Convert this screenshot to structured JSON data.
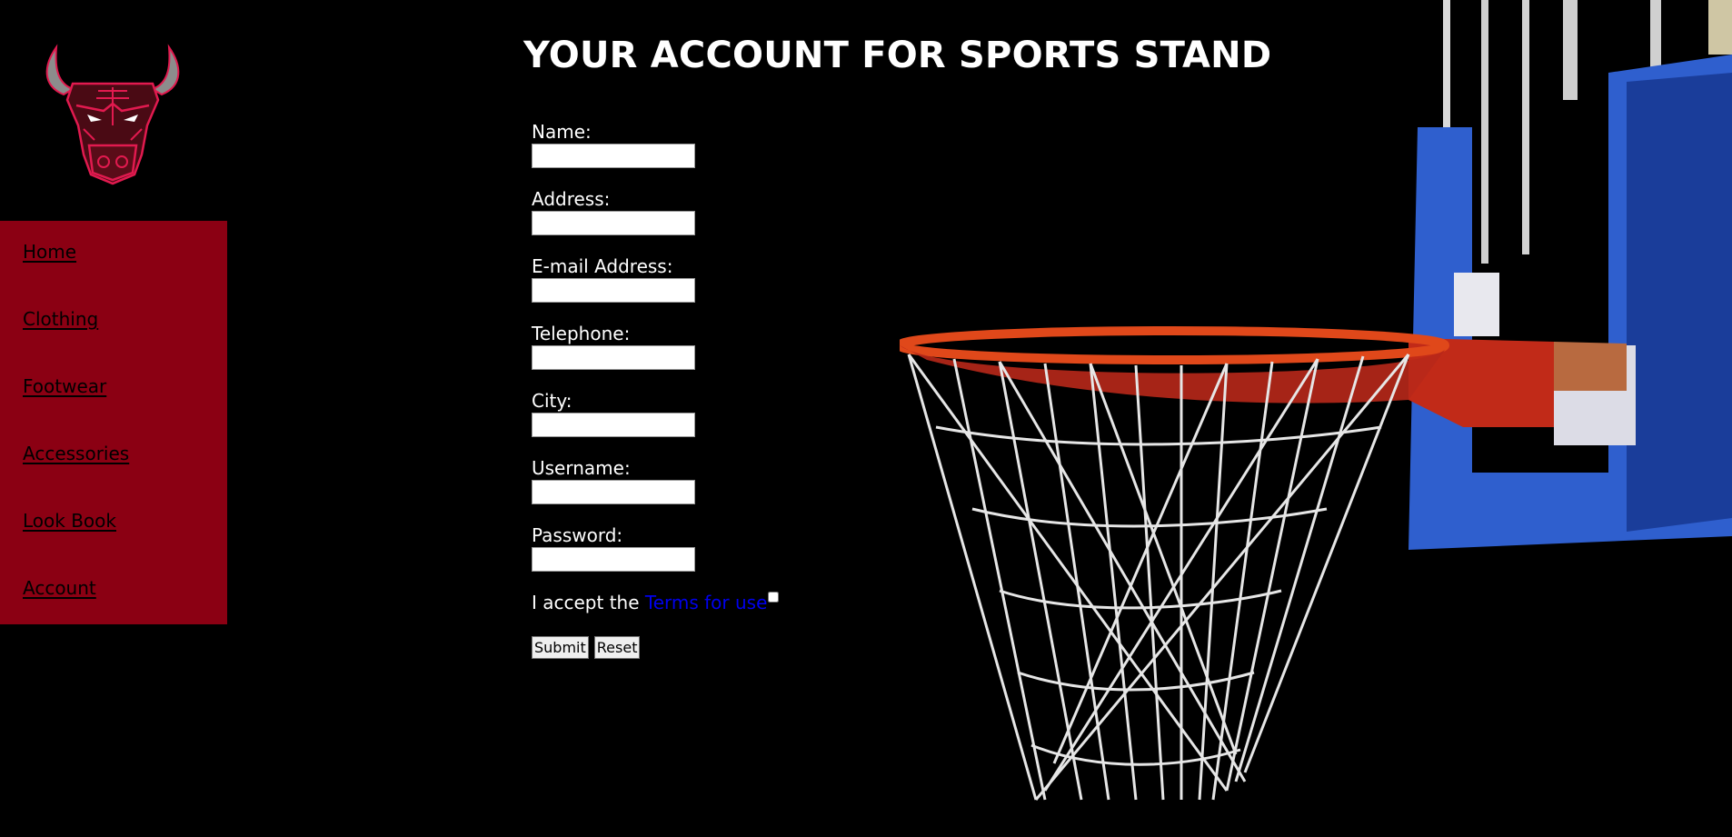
{
  "page": {
    "title": "YOUR ACCOUNT FOR SPORTS STAND"
  },
  "sidebar": {
    "items": [
      {
        "label": "Home"
      },
      {
        "label": "Clothing"
      },
      {
        "label": "Footwear"
      },
      {
        "label": "Accessories"
      },
      {
        "label": "Look Book"
      },
      {
        "label": "Account"
      }
    ]
  },
  "form": {
    "fields": [
      {
        "label": "Name:",
        "value": ""
      },
      {
        "label": "Address:",
        "value": ""
      },
      {
        "label": "E-mail Address:",
        "value": ""
      },
      {
        "label": "Telephone:",
        "value": ""
      },
      {
        "label": "City:",
        "value": ""
      },
      {
        "label": "Username:",
        "value": ""
      },
      {
        "label": "Password:",
        "value": ""
      }
    ],
    "terms_prefix": "I accept the ",
    "terms_link": "Terms for use",
    "terms_checked": false,
    "submit_label": "Submit",
    "reset_label": "Reset"
  },
  "colors": {
    "background": "#000000",
    "sidebar": "#8b0013",
    "link": "#0000ee",
    "text": "#ffffff"
  },
  "icons": {
    "logo": "bull-head-logo",
    "hero": "basketball-hoop-image"
  }
}
